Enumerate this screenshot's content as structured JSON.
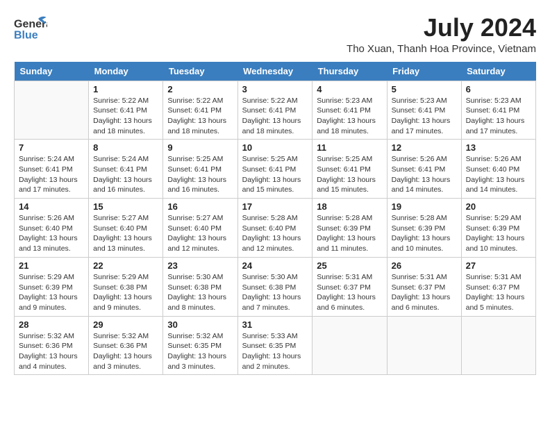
{
  "header": {
    "logo_general": "General",
    "logo_blue": "Blue",
    "month_year": "July 2024",
    "location": "Tho Xuan, Thanh Hoa Province, Vietnam"
  },
  "days_of_week": [
    "Sunday",
    "Monday",
    "Tuesday",
    "Wednesday",
    "Thursday",
    "Friday",
    "Saturday"
  ],
  "weeks": [
    [
      {
        "day": "",
        "info": ""
      },
      {
        "day": "1",
        "info": "Sunrise: 5:22 AM\nSunset: 6:41 PM\nDaylight: 13 hours\nand 18 minutes."
      },
      {
        "day": "2",
        "info": "Sunrise: 5:22 AM\nSunset: 6:41 PM\nDaylight: 13 hours\nand 18 minutes."
      },
      {
        "day": "3",
        "info": "Sunrise: 5:22 AM\nSunset: 6:41 PM\nDaylight: 13 hours\nand 18 minutes."
      },
      {
        "day": "4",
        "info": "Sunrise: 5:23 AM\nSunset: 6:41 PM\nDaylight: 13 hours\nand 18 minutes."
      },
      {
        "day": "5",
        "info": "Sunrise: 5:23 AM\nSunset: 6:41 PM\nDaylight: 13 hours\nand 17 minutes."
      },
      {
        "day": "6",
        "info": "Sunrise: 5:23 AM\nSunset: 6:41 PM\nDaylight: 13 hours\nand 17 minutes."
      }
    ],
    [
      {
        "day": "7",
        "info": "Sunrise: 5:24 AM\nSunset: 6:41 PM\nDaylight: 13 hours\nand 17 minutes."
      },
      {
        "day": "8",
        "info": "Sunrise: 5:24 AM\nSunset: 6:41 PM\nDaylight: 13 hours\nand 16 minutes."
      },
      {
        "day": "9",
        "info": "Sunrise: 5:25 AM\nSunset: 6:41 PM\nDaylight: 13 hours\nand 16 minutes."
      },
      {
        "day": "10",
        "info": "Sunrise: 5:25 AM\nSunset: 6:41 PM\nDaylight: 13 hours\nand 15 minutes."
      },
      {
        "day": "11",
        "info": "Sunrise: 5:25 AM\nSunset: 6:41 PM\nDaylight: 13 hours\nand 15 minutes."
      },
      {
        "day": "12",
        "info": "Sunrise: 5:26 AM\nSunset: 6:41 PM\nDaylight: 13 hours\nand 14 minutes."
      },
      {
        "day": "13",
        "info": "Sunrise: 5:26 AM\nSunset: 6:40 PM\nDaylight: 13 hours\nand 14 minutes."
      }
    ],
    [
      {
        "day": "14",
        "info": "Sunrise: 5:26 AM\nSunset: 6:40 PM\nDaylight: 13 hours\nand 13 minutes."
      },
      {
        "day": "15",
        "info": "Sunrise: 5:27 AM\nSunset: 6:40 PM\nDaylight: 13 hours\nand 13 minutes."
      },
      {
        "day": "16",
        "info": "Sunrise: 5:27 AM\nSunset: 6:40 PM\nDaylight: 13 hours\nand 12 minutes."
      },
      {
        "day": "17",
        "info": "Sunrise: 5:28 AM\nSunset: 6:40 PM\nDaylight: 13 hours\nand 12 minutes."
      },
      {
        "day": "18",
        "info": "Sunrise: 5:28 AM\nSunset: 6:39 PM\nDaylight: 13 hours\nand 11 minutes."
      },
      {
        "day": "19",
        "info": "Sunrise: 5:28 AM\nSunset: 6:39 PM\nDaylight: 13 hours\nand 10 minutes."
      },
      {
        "day": "20",
        "info": "Sunrise: 5:29 AM\nSunset: 6:39 PM\nDaylight: 13 hours\nand 10 minutes."
      }
    ],
    [
      {
        "day": "21",
        "info": "Sunrise: 5:29 AM\nSunset: 6:39 PM\nDaylight: 13 hours\nand 9 minutes."
      },
      {
        "day": "22",
        "info": "Sunrise: 5:29 AM\nSunset: 6:38 PM\nDaylight: 13 hours\nand 9 minutes."
      },
      {
        "day": "23",
        "info": "Sunrise: 5:30 AM\nSunset: 6:38 PM\nDaylight: 13 hours\nand 8 minutes."
      },
      {
        "day": "24",
        "info": "Sunrise: 5:30 AM\nSunset: 6:38 PM\nDaylight: 13 hours\nand 7 minutes."
      },
      {
        "day": "25",
        "info": "Sunrise: 5:31 AM\nSunset: 6:37 PM\nDaylight: 13 hours\nand 6 minutes."
      },
      {
        "day": "26",
        "info": "Sunrise: 5:31 AM\nSunset: 6:37 PM\nDaylight: 13 hours\nand 6 minutes."
      },
      {
        "day": "27",
        "info": "Sunrise: 5:31 AM\nSunset: 6:37 PM\nDaylight: 13 hours\nand 5 minutes."
      }
    ],
    [
      {
        "day": "28",
        "info": "Sunrise: 5:32 AM\nSunset: 6:36 PM\nDaylight: 13 hours\nand 4 minutes."
      },
      {
        "day": "29",
        "info": "Sunrise: 5:32 AM\nSunset: 6:36 PM\nDaylight: 13 hours\nand 3 minutes."
      },
      {
        "day": "30",
        "info": "Sunrise: 5:32 AM\nSunset: 6:35 PM\nDaylight: 13 hours\nand 3 minutes."
      },
      {
        "day": "31",
        "info": "Sunrise: 5:33 AM\nSunset: 6:35 PM\nDaylight: 13 hours\nand 2 minutes."
      },
      {
        "day": "",
        "info": ""
      },
      {
        "day": "",
        "info": ""
      },
      {
        "day": "",
        "info": ""
      }
    ]
  ]
}
